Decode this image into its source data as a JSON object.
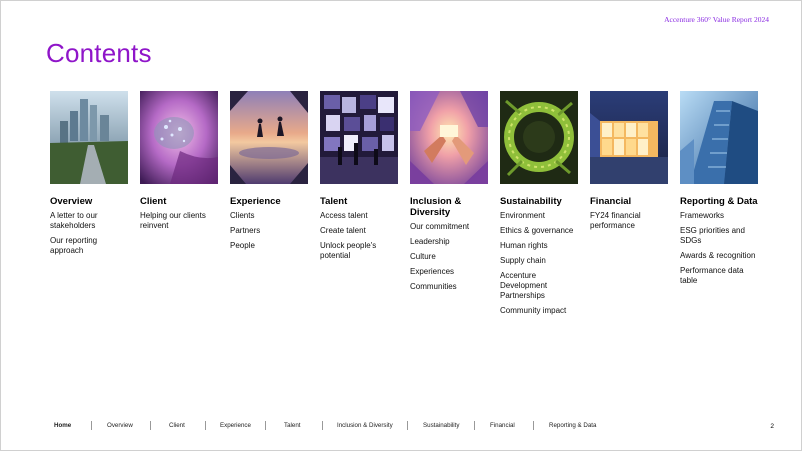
{
  "header": {
    "report_title": "Accenture 360° Value Report 2024",
    "page_title": "Contents"
  },
  "sections": [
    {
      "title": "Overview",
      "links": [
        "A letter to our stakeholders",
        "Our reporting approach"
      ]
    },
    {
      "title": "Client",
      "links": [
        "Helping our clients reinvent"
      ]
    },
    {
      "title": "Experience",
      "links": [
        "Clients",
        "Partners",
        "People"
      ]
    },
    {
      "title": "Talent",
      "links": [
        "Access talent",
        "Create talent",
        "Unlock people's potential"
      ]
    },
    {
      "title": "Inclusion & Diversity",
      "links": [
        "Our commitment",
        "Leadership",
        "Culture",
        "Experiences",
        "Communities"
      ]
    },
    {
      "title": "Sustainability",
      "links": [
        "Environment",
        "Ethics & governance",
        "Human rights",
        "Supply chain",
        "Accenture Development Partnerships",
        "Community impact"
      ]
    },
    {
      "title": "Financial",
      "links": [
        "FY24 financial performance"
      ]
    },
    {
      "title": "Reporting & Data",
      "links": [
        "Frameworks",
        "ESG priorities and SDGs",
        "Awards & recognition",
        "Performance data table"
      ]
    }
  ],
  "footer": {
    "nav": [
      "Home",
      "Overview",
      "Client",
      "Experience",
      "Talent",
      "Inclusion & Diversity",
      "Sustainability",
      "Financial",
      "Reporting & Data"
    ],
    "page_number": "2"
  },
  "colors": {
    "accent": "#8f15c9"
  }
}
